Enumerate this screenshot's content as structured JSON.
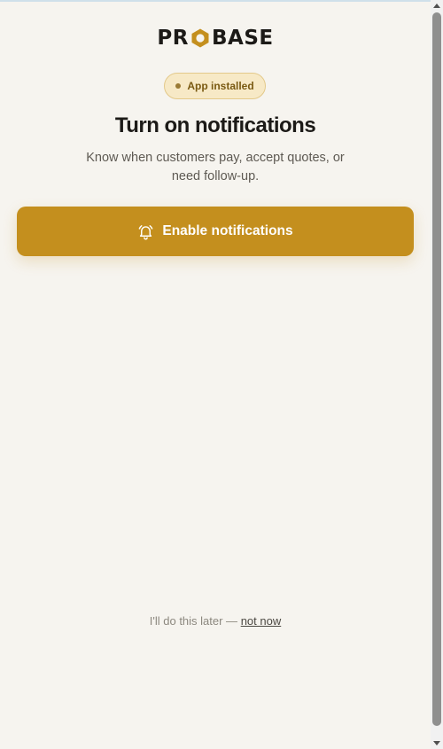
{
  "logo": {
    "text_left": "PR",
    "text_right": "BASE",
    "hex_color": "#c48f1e"
  },
  "badge": {
    "label": "App installed"
  },
  "heading": {
    "title": "Turn on notifications",
    "subtitle": "Know when customers pay, accept quotes, or need follow-up."
  },
  "enable_button": {
    "label": "Enable notifications",
    "icon": "bell-icon",
    "color": "#c48f1e"
  },
  "later": {
    "prefix": "I'll do this later — ",
    "link": "not now"
  }
}
